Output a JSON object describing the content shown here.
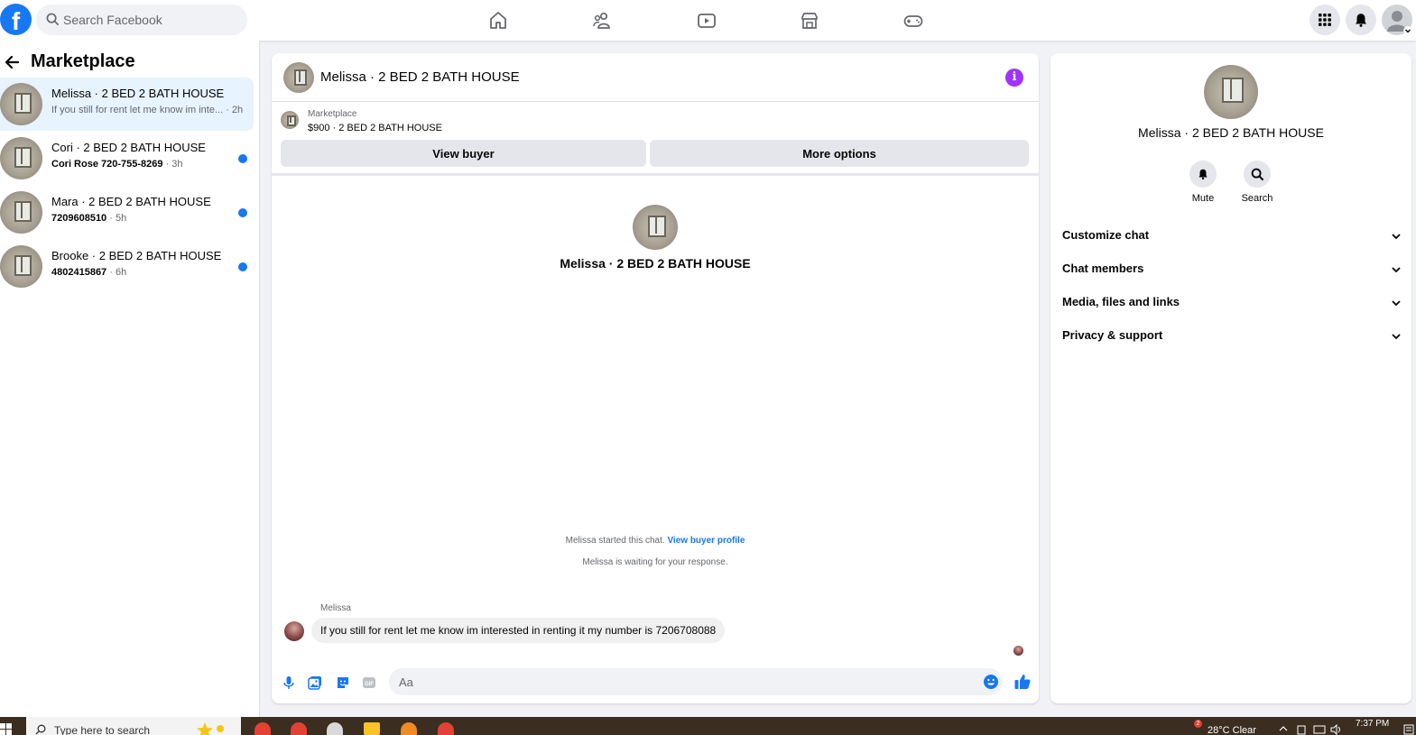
{
  "topbar": {
    "logo": "f",
    "search_placeholder": "Search Facebook",
    "nav_icons": [
      "home-icon",
      "friends-icon",
      "watch-icon",
      "marketplace-icon",
      "gaming-icon"
    ],
    "right_icons": [
      "menu-grid-icon",
      "notifications-icon",
      "account-icon"
    ]
  },
  "sidebar": {
    "back_icon": "arrow-left-icon",
    "title": "Marketplace",
    "conversations": [
      {
        "name": "Melissa · 2 BED 2 BATH HOUSE",
        "preview": "If you still for rent let me know im inte...",
        "time": "· 2h",
        "active": true,
        "unread": false
      },
      {
        "name": "Cori · 2 BED 2 BATH HOUSE",
        "preview": "Cori Rose 720-755-8269",
        "time": "· 3h",
        "active": false,
        "unread": true
      },
      {
        "name": "Mara · 2 BED 2 BATH HOUSE",
        "preview": "7209608510",
        "time": "· 5h",
        "active": false,
        "unread": true
      },
      {
        "name": "Brooke · 2 BED 2 BATH HOUSE",
        "preview": "4802415867",
        "time": "· 6h",
        "active": false,
        "unread": true
      }
    ]
  },
  "chat": {
    "title": "Melissa · 2 BED 2 BATH HOUSE",
    "info_icon": "info-icon",
    "marketplace_label": "Marketplace",
    "listing": "$900 · 2 BED 2 BATH HOUSE",
    "view_buyer": "View buyer",
    "more_options": "More options",
    "intro_name": "Melissa · 2 BED 2 BATH HOUSE",
    "started_text": "Melissa started this chat.",
    "view_profile": "View buyer profile",
    "waiting_text": "Melissa is waiting for your response.",
    "sender": "Melissa",
    "message": "If you still for rent let me know im interested in renting it  my number is 7206708088",
    "composer_placeholder": "Aa",
    "composer_icons": [
      "microphone-icon",
      "photo-icon",
      "sticker-icon",
      "gif-icon",
      "emoji-icon",
      "thumbs-up-icon"
    ]
  },
  "details": {
    "name": "Melissa · 2 BED 2 BATH HOUSE",
    "actions": [
      {
        "label": "Mute",
        "icon": "bell-icon"
      },
      {
        "label": "Search",
        "icon": "search-icon"
      }
    ],
    "sections": [
      "Customize chat",
      "Chat members",
      "Media, files and links",
      "Privacy & support"
    ]
  },
  "taskbar": {
    "search_placeholder": "Type here to search",
    "weather": "28°C  Clear",
    "time": "7:37 PM",
    "notification_count": "2"
  },
  "colors": {
    "brand": "#1877f2",
    "info": "#a033ff",
    "active_row": "#e7f3ff",
    "taskbar": "#3b2d1f"
  }
}
